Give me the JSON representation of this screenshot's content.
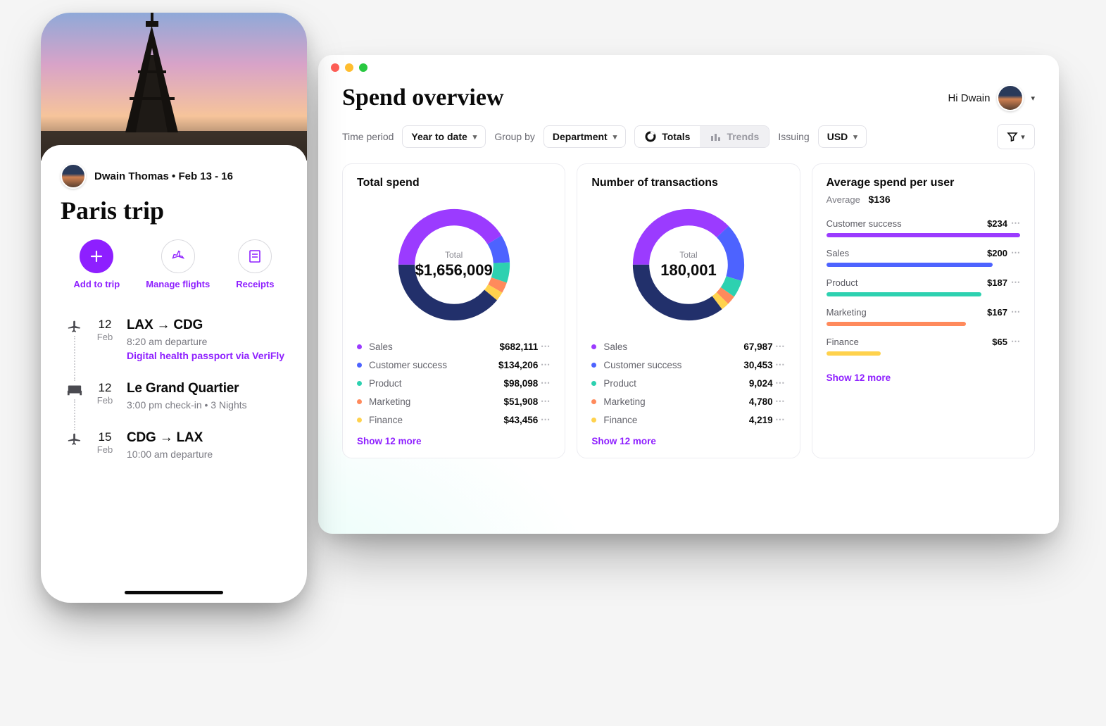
{
  "colors": {
    "purple": "#9b3bff",
    "blue": "#4d63ff",
    "teal": "#2dd1b0",
    "orange": "#ff8a5c",
    "yellow": "#ffd24d",
    "navy": "#22306b"
  },
  "mobile": {
    "user_name": "Dwain Thomas",
    "date_range": "Feb 13 - 16",
    "trip_title": "Paris trip",
    "actions": {
      "add": "Add to trip",
      "flights": "Manage flights",
      "receipts": "Receipts"
    },
    "itinerary": [
      {
        "icon": "plane",
        "day": "12",
        "month": "Feb",
        "title": "LAX → CDG",
        "subtitle": "8:20 am departure",
        "link": "Digital health passport via VeriFly"
      },
      {
        "icon": "bed",
        "day": "12",
        "month": "Feb",
        "title": "Le Grand Quartier",
        "subtitle": "3:00 pm check-in • 3 Nights"
      },
      {
        "icon": "plane",
        "day": "15",
        "month": "Feb",
        "title": "CDG → LAX",
        "subtitle": "10:00 am departure"
      }
    ]
  },
  "desktop": {
    "page_title": "Spend overview",
    "greeting": "Hi Dwain",
    "filters": {
      "time_label": "Time period",
      "time_value": "Year to date",
      "group_label": "Group by",
      "group_value": "Department",
      "view_totals": "Totals",
      "view_trends": "Trends",
      "issuing_label": "Issuing",
      "issuing_value": "USD"
    },
    "cards": {
      "spend": {
        "title": "Total spend",
        "center_label": "Total",
        "center_value": "$1,656,009",
        "rows": [
          {
            "name": "Sales",
            "value": "$682,111",
            "color": "purple"
          },
          {
            "name": "Customer success",
            "value": "$134,206",
            "color": "blue"
          },
          {
            "name": "Product",
            "value": "$98,098",
            "color": "teal"
          },
          {
            "name": "Marketing",
            "value": "$51,908",
            "color": "orange"
          },
          {
            "name": "Finance",
            "value": "$43,456",
            "color": "yellow"
          }
        ],
        "show_more": "Show 12 more"
      },
      "tx": {
        "title": "Number of transactions",
        "center_label": "Total",
        "center_value": "180,001",
        "rows": [
          {
            "name": "Sales",
            "value": "67,987",
            "color": "purple"
          },
          {
            "name": "Customer success",
            "value": "30,453",
            "color": "blue"
          },
          {
            "name": "Product",
            "value": "9,024",
            "color": "teal"
          },
          {
            "name": "Marketing",
            "value": "4,780",
            "color": "orange"
          },
          {
            "name": "Finance",
            "value": "4,219",
            "color": "yellow"
          }
        ],
        "show_more": "Show 12 more"
      },
      "avg": {
        "title": "Average spend per user",
        "sub_label": "Average",
        "sub_value": "$136",
        "rows": [
          {
            "name": "Customer success",
            "value": "$234",
            "pct": 100,
            "color": "purple"
          },
          {
            "name": "Sales",
            "value": "$200",
            "pct": 86,
            "color": "blue"
          },
          {
            "name": "Product",
            "value": "$187",
            "pct": 80,
            "color": "teal"
          },
          {
            "name": "Marketing",
            "value": "$167",
            "pct": 72,
            "color": "orange"
          },
          {
            "name": "Finance",
            "value": "$65",
            "pct": 28,
            "color": "yellow"
          }
        ],
        "show_more": "Show 12 more"
      }
    }
  },
  "chart_data": [
    {
      "type": "pie",
      "title": "Total spend",
      "series": [
        {
          "name": "Sales",
          "value": 682111
        },
        {
          "name": "Customer success",
          "value": 134206
        },
        {
          "name": "Product",
          "value": 98098
        },
        {
          "name": "Marketing",
          "value": 51908
        },
        {
          "name": "Finance",
          "value": 43456
        },
        {
          "name": "Other (12 more)",
          "value": 646230
        }
      ],
      "total": 1656009,
      "currency": "USD"
    },
    {
      "type": "pie",
      "title": "Number of transactions",
      "series": [
        {
          "name": "Sales",
          "value": 67987
        },
        {
          "name": "Customer success",
          "value": 30453
        },
        {
          "name": "Product",
          "value": 9024
        },
        {
          "name": "Marketing",
          "value": 4780
        },
        {
          "name": "Finance",
          "value": 4219
        },
        {
          "name": "Other (12 more)",
          "value": 63538
        }
      ],
      "total": 180001
    },
    {
      "type": "bar",
      "title": "Average spend per user",
      "xlabel": "",
      "ylabel": "USD",
      "categories": [
        "Customer success",
        "Sales",
        "Product",
        "Marketing",
        "Finance"
      ],
      "values": [
        234,
        200,
        187,
        167,
        65
      ],
      "average": 136
    }
  ]
}
